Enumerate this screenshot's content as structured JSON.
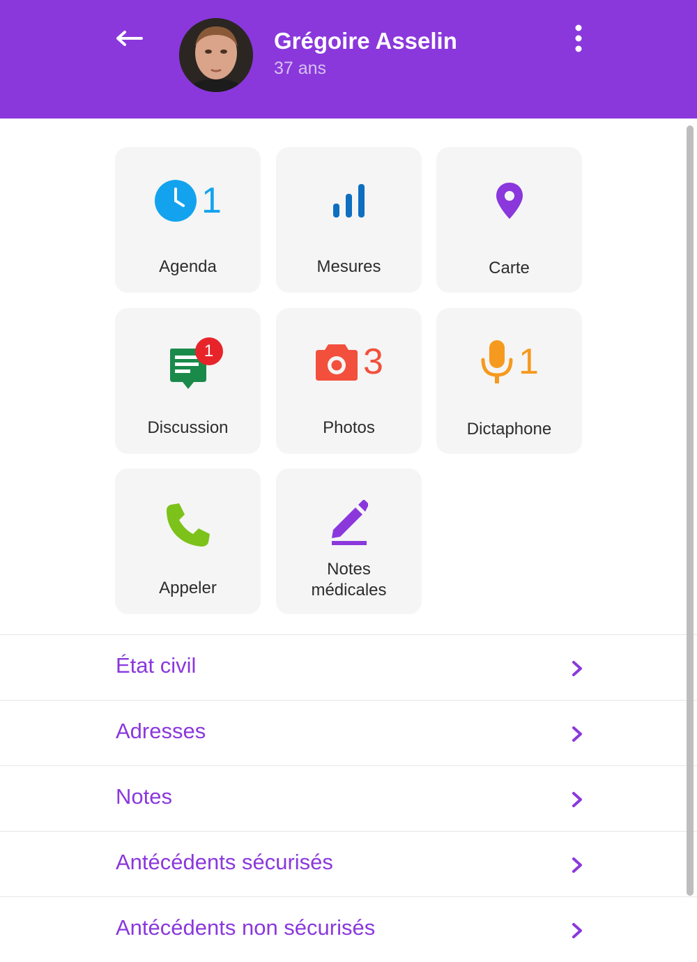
{
  "header": {
    "patient_name": "Grégoire Asselin",
    "patient_age": "37 ans",
    "background": "#8a38dc"
  },
  "tiles": [
    {
      "label": "Agenda",
      "icon": "clock-icon",
      "count": "1",
      "color": "#13a3ee"
    },
    {
      "label": "Mesures",
      "icon": "bar-chart-icon",
      "count": "",
      "color": "#0e6fc0"
    },
    {
      "label": "Carte",
      "icon": "map-pin-icon",
      "count": "",
      "color": "#8a38dc"
    },
    {
      "label": "Discussion",
      "icon": "chat-icon",
      "badge": "1",
      "color": "#1a8a4a"
    },
    {
      "label": "Photos",
      "icon": "camera-icon",
      "count": "3",
      "color": "#f2503c"
    },
    {
      "label": "Dictaphone",
      "icon": "microphone-icon",
      "count": "1",
      "color": "#f59a1e"
    },
    {
      "label": "Appeler",
      "icon": "phone-icon",
      "count": "",
      "color": "#7cc21a"
    },
    {
      "label_line1": "Notes",
      "label_line2": "médicales",
      "icon": "pencil-icon",
      "count": "",
      "color": "#8a38dc"
    }
  ],
  "list": [
    {
      "label": "État civil"
    },
    {
      "label": "Adresses"
    },
    {
      "label": "Notes"
    },
    {
      "label": "Antécédents sécurisés"
    },
    {
      "label": "Antécédents non sécurisés"
    }
  ],
  "accent": "#8a38dc"
}
